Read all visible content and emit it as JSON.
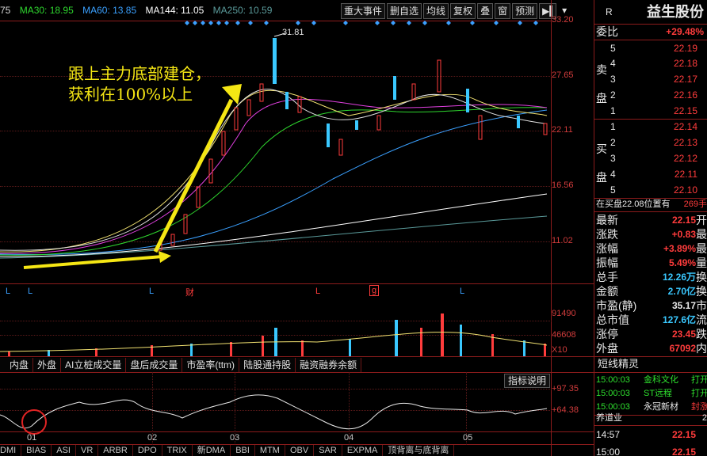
{
  "ma_bar": {
    "prefix": "75",
    "ma30": "MA30: 18.95",
    "ma60": "MA60: 13.85",
    "ma144": "MA144: 11.05",
    "ma250": "MA250: 10.59",
    "colors": {
      "ma30": "#2ed62e",
      "ma60": "#3aa0ff",
      "ma144": "#ffffff",
      "ma250": "#5a9a9a"
    }
  },
  "toolbar": {
    "items": [
      "重大事件",
      "删自选",
      "均线",
      "复权",
      "叠",
      "窗",
      "预测"
    ]
  },
  "price_axis": {
    "ticks": [
      "33.20",
      "27.65",
      "22.11",
      "16.56",
      "11.02"
    ]
  },
  "annotation": {
    "line1": "跟上主力底部建仓，",
    "line2": "获利在100%以上"
  },
  "peak_label": "31.81",
  "markers": {
    "l_label": "L",
    "cai": "财",
    "g": "g"
  },
  "volume_axis": {
    "ticks": [
      "91490",
      "46608",
      "X10"
    ]
  },
  "indicator_tabs": [
    "内盘",
    "外盘",
    "AI立桩成交量",
    "盘后成交量",
    "市盈率(ttm)",
    "陆股通持股",
    "融资融券余额"
  ],
  "indicator": {
    "explain_button": "指标说明",
    "axis": [
      "+97.35",
      "+64.38"
    ],
    "months": [
      "01",
      "02",
      "03",
      "04",
      "05"
    ]
  },
  "bottom_tabs": [
    "DMI",
    "BIAS",
    "ASI",
    "VR",
    "ARBR",
    "DPO",
    "TRIX",
    "新DMA",
    "BBI",
    "MTM",
    "OBV",
    "SAR",
    "EXPMA",
    "顶背离与底背离"
  ],
  "side": {
    "r_label": "R",
    "stock_name": "益生股份",
    "weibi_label": "委比",
    "weibi_value": "+29.48%",
    "sell_label": "卖盘",
    "buy_label": "买盘",
    "sell": [
      {
        "level": "5",
        "price": "22.19"
      },
      {
        "level": "4",
        "price": "22.18"
      },
      {
        "level": "3",
        "price": "22.17"
      },
      {
        "level": "2",
        "price": "22.16"
      },
      {
        "level": "1",
        "price": "22.15"
      }
    ],
    "buy": [
      {
        "level": "1",
        "price": "22.14"
      },
      {
        "level": "2",
        "price": "22.13"
      },
      {
        "level": "3",
        "price": "22.12"
      },
      {
        "level": "4",
        "price": "22.11"
      },
      {
        "level": "5",
        "price": "22.10"
      }
    ],
    "notice": "在买盘22.08位置有",
    "notice_tail": "269手",
    "stats": [
      {
        "label": "最新",
        "value": "22.15",
        "tail": "开"
      },
      {
        "label": "涨跌",
        "value": "+0.83",
        "tail": "最"
      },
      {
        "label": "涨幅",
        "value": "+3.89%",
        "tail": "最"
      },
      {
        "label": "振幅",
        "value": "5.49%",
        "tail": "量"
      },
      {
        "label": "总手",
        "value": "12.26万",
        "tail": "换"
      },
      {
        "label": "金额",
        "value": "2.70亿",
        "tail": "换"
      },
      {
        "label": "市盈(静)",
        "value": "35.17",
        "tail": "市"
      },
      {
        "label": "总市值",
        "value": "127.6亿",
        "tail": "流"
      },
      {
        "label": "涨停",
        "value": "23.45",
        "tail": "跌"
      },
      {
        "label": "外盘",
        "value": "67092",
        "tail": "内"
      }
    ],
    "news_title": "短线精灵",
    "news": [
      {
        "time": "15:00:03",
        "name": "金科文化",
        "act": "打开"
      },
      {
        "time": "15:00:03",
        "name": "ST远程",
        "act": "打开"
      },
      {
        "time": "15:00:03",
        "name": "永冠新材",
        "act": "封涨"
      }
    ],
    "nest_label": "养道业",
    "nest_value": "2",
    "ticks": [
      {
        "time": "14:57",
        "price": "22.15"
      },
      {
        "time": "15:00",
        "price": "22.15"
      }
    ]
  }
}
